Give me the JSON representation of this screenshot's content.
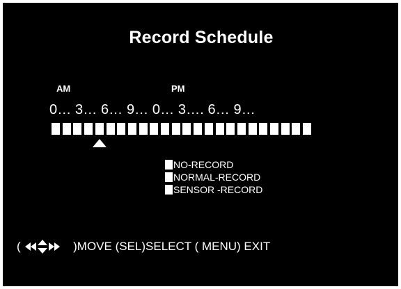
{
  "screen": {
    "title": "Record Schedule"
  },
  "timeline": {
    "am_label": "AM",
    "pm_label": "PM",
    "hour_scale": "0… 3… 6… 9… 0… 3…. 6… 9…",
    "slot_count": 24,
    "cursor_slot": 4
  },
  "legend": [
    {
      "label": "NO-RECORD"
    },
    {
      "label": "NORMAL-RECORD"
    },
    {
      "label": "SENSOR -RECORD"
    }
  ],
  "help": {
    "open_paren": "(",
    "move_text": ")MOVE (SEL)SELECT   ( MENU) EXIT",
    "icons": [
      "arrow-left-icon",
      "arrow-up-down-icon",
      "arrow-right-icon"
    ]
  },
  "colors": {
    "background": "#000000",
    "foreground": "#ffffff",
    "border": "#ffffff"
  }
}
